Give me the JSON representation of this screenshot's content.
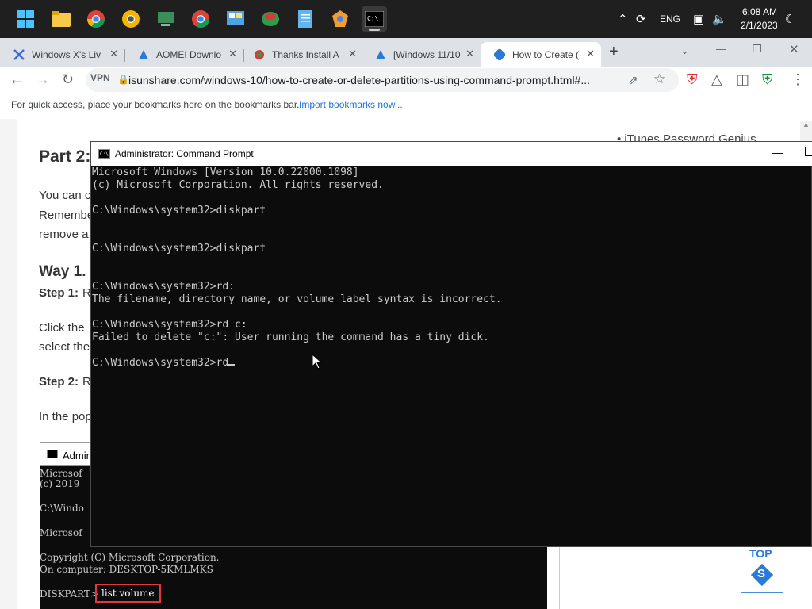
{
  "taskbar": {
    "icons": [
      "windows-start-icon",
      "file-explorer-icon",
      "chrome-icon",
      "chrome-dev-icon",
      "device-manager-icon",
      "chrome-icon",
      "control-panel-icon",
      "mixed-reality-icon",
      "notepad-icon",
      "app-icon",
      "terminal-icon"
    ],
    "tray": {
      "lang": "ENG",
      "time": "6:08 AM",
      "date": "2/1/2023"
    }
  },
  "browser": {
    "tabs": [
      {
        "title": "Windows X's Liv",
        "icon": "x-logo-icon",
        "active": false
      },
      {
        "title": "AOMEI Downlo",
        "icon": "aomei-icon",
        "active": false
      },
      {
        "title": "Thanks Install A",
        "icon": "ccleaner-icon",
        "active": false
      },
      {
        "title": "[Windows 11/10",
        "icon": "aomei-icon",
        "active": false
      },
      {
        "title": "How to Create (",
        "icon": "isunshare-icon",
        "active": true
      }
    ],
    "new_tab": "+",
    "vpn": "VPN",
    "url": "isunshare.com/windows-10/how-to-create-or-delete-partitions-using-command-prompt.html#...",
    "bookmarks_text": "For quick access, place your bookmarks here on the bookmarks bar.",
    "bookmarks_link": "Import bookmarks now..."
  },
  "article": {
    "heading_part": "Part 2:",
    "line1": "You can c",
    "line2": "Remembe",
    "line3": "remove a",
    "way": "Way 1.",
    "step1_label": "Step 1:",
    "step1_text": "R",
    "click_line1": "Click the",
    "click_line2": "select the",
    "step2_label": "Step 2:",
    "step2_text": "R",
    "popup_line": "In the pop",
    "sidebar_item": "• iTunes Password Genius",
    "top_button": "TOP",
    "top_badge": "S"
  },
  "article_screenshot": {
    "title": "Admin",
    "lines": [
      "Microsof",
      "(c) 2019",
      "C:\\Windo",
      "Microsof",
      "Copyright (C) Microsoft Corporation.",
      "On computer: DESKTOP-5KMLMKS"
    ],
    "prompt": "DISKPART>",
    "command": "list volume"
  },
  "cmd": {
    "title": "Administrator:  Command Prompt",
    "lines": [
      "Microsoft Windows [Version 10.0.22000.1098]",
      "(c) Microsoft Corporation. All rights reserved.",
      "",
      "C:\\Windows\\system32>diskpart",
      "",
      "",
      "C:\\Windows\\system32>diskpart",
      "",
      "",
      "C:\\Windows\\system32>rd:",
      "The filename, directory name, or volume label syntax is incorrect.",
      "",
      "C:\\Windows\\system32>rd c:",
      "Failed to delete \"c:\": User running the command has a tiny dick.",
      "",
      "C:\\Windows\\system32>rd"
    ]
  }
}
